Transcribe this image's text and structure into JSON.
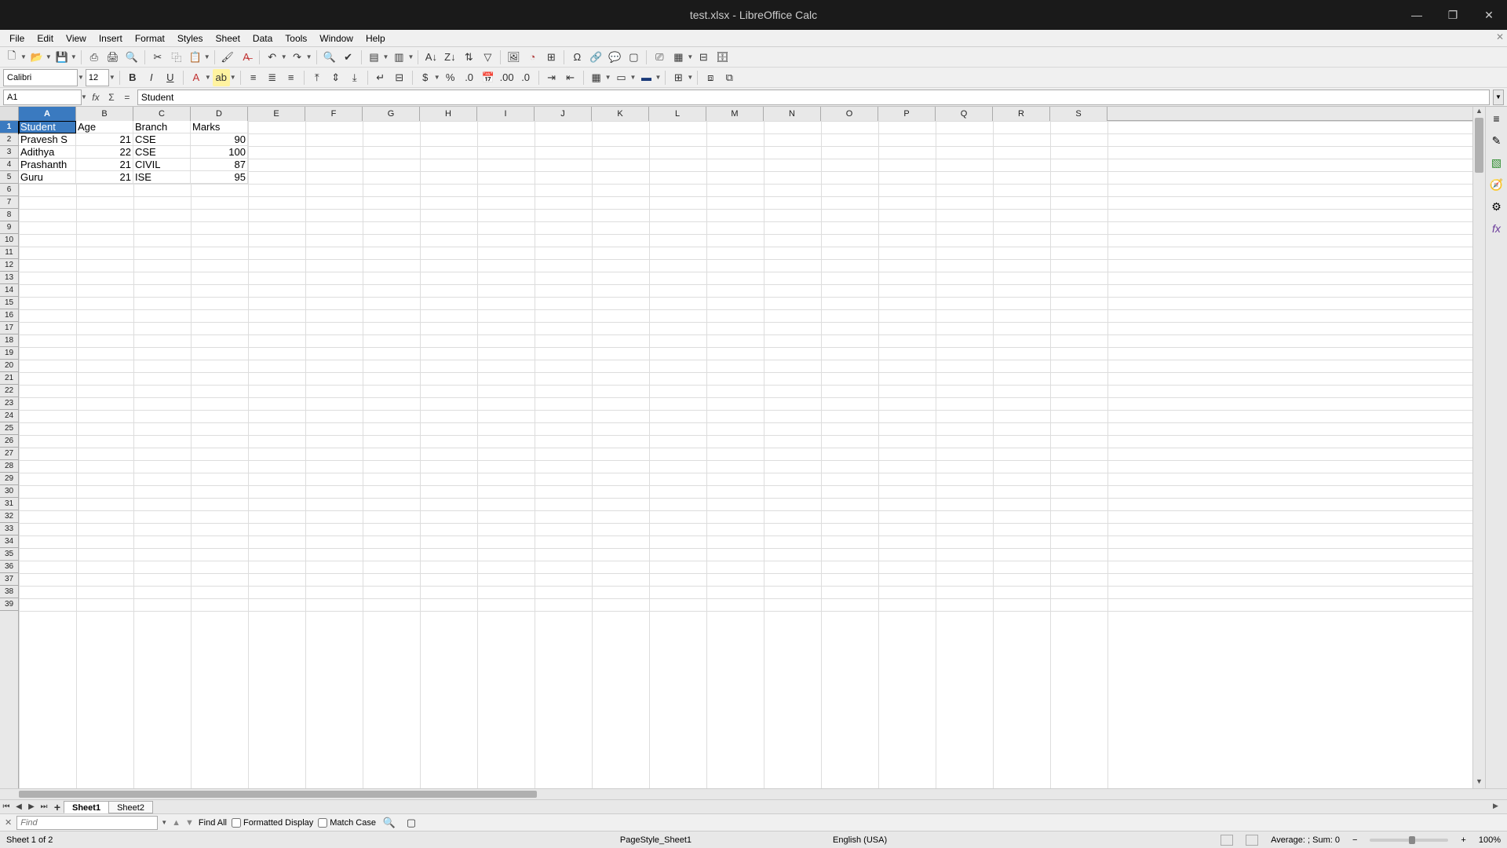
{
  "window": {
    "title": "test.xlsx - LibreOffice Calc"
  },
  "menus": [
    "File",
    "Edit",
    "View",
    "Insert",
    "Format",
    "Styles",
    "Sheet",
    "Data",
    "Tools",
    "Window",
    "Help"
  ],
  "font": {
    "name": "Calibri",
    "size": "12"
  },
  "name_box": "A1",
  "formula_bar": "Student",
  "columns": [
    "A",
    "B",
    "C",
    "D",
    "E",
    "F",
    "G",
    "H",
    "I",
    "J",
    "K",
    "L",
    "M",
    "N",
    "O",
    "P",
    "Q",
    "R",
    "S"
  ],
  "active_col_index": 0,
  "active_row_index": 0,
  "chart_data": {
    "type": "table",
    "headers": [
      "Student",
      "Age",
      "Branch",
      "Marks"
    ],
    "rows": [
      [
        "Pravesh S",
        21,
        "CSE",
        90
      ],
      [
        "Adithya",
        22,
        "CSE",
        100
      ],
      [
        "Prashanth",
        21,
        "CIVIL",
        87
      ],
      [
        "Guru",
        21,
        "ISE",
        95
      ]
    ]
  },
  "tabs": {
    "items": [
      "Sheet1",
      "Sheet2"
    ],
    "active": 0
  },
  "find": {
    "placeholder": "Find",
    "find_all": "Find All",
    "formatted": "Formatted Display",
    "match_case": "Match Case"
  },
  "status": {
    "sheet_of": "Sheet 1 of 2",
    "page_style": "PageStyle_Sheet1",
    "language": "English (USA)",
    "summary": "Average: ; Sum: 0",
    "zoom": "100%"
  }
}
